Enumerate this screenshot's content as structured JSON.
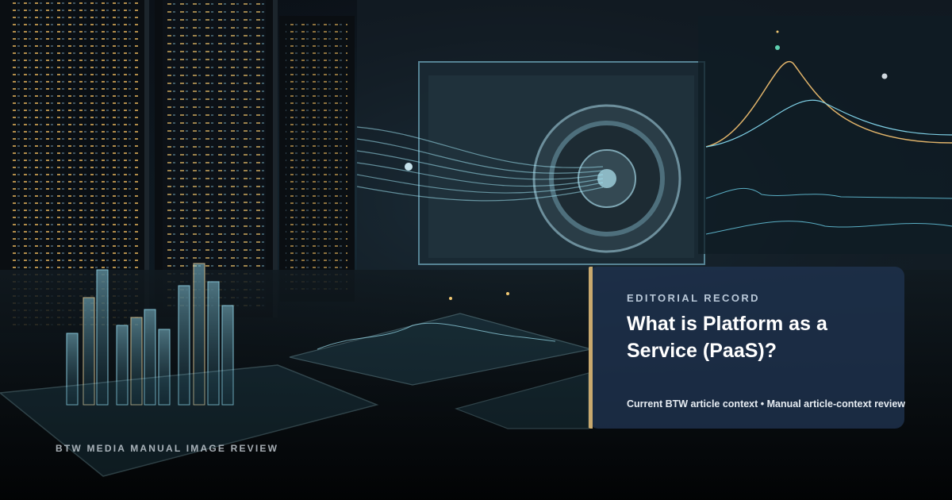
{
  "hero": {
    "scene_description_icons": [
      "server-rack-icon",
      "bank-vault-icon",
      "data-chart-icon"
    ],
    "watermark": "BTW MEDIA MANUAL IMAGE REVIEW"
  },
  "card": {
    "kicker": "EDITORIAL RECORD",
    "title": "What is Platform as a Service (PaaS)?",
    "meta": "Current BTW article context • Manual article-context review",
    "background": "#1e324e",
    "accent": "#c9a96e"
  }
}
